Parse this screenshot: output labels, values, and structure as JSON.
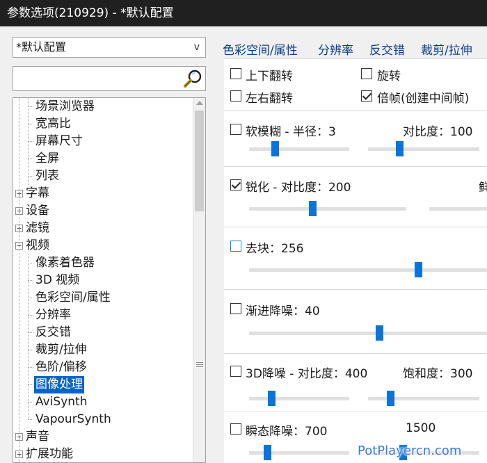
{
  "window": {
    "title": "参数选项(210929) - *默认配置"
  },
  "profile": {
    "selected": "*默认配置",
    "arrow": "v"
  },
  "search": {
    "value": "",
    "placeholder": ""
  },
  "tree": {
    "items": [
      {
        "label": "场景浏览器",
        "level": 1
      },
      {
        "label": "宽高比",
        "level": 1
      },
      {
        "label": "屏幕尺寸",
        "level": 1
      },
      {
        "label": "全屏",
        "level": 1
      },
      {
        "label": "列表",
        "level": 1
      },
      {
        "label": "字幕",
        "level": 0,
        "expander": "+"
      },
      {
        "label": "设备",
        "level": 0,
        "expander": "+"
      },
      {
        "label": "滤镜",
        "level": 0,
        "expander": "+"
      },
      {
        "label": "视频",
        "level": 0,
        "expander": "−"
      },
      {
        "label": "像素着色器",
        "level": 1
      },
      {
        "label": "3D 视频",
        "level": 1
      },
      {
        "label": "色彩空间/属性",
        "level": 1
      },
      {
        "label": "分辨率",
        "level": 1
      },
      {
        "label": "反交错",
        "level": 1
      },
      {
        "label": "裁剪/拉伸",
        "level": 1
      },
      {
        "label": "色阶/偏移",
        "level": 1
      },
      {
        "label": "图像处理",
        "level": 1,
        "selected": true
      },
      {
        "label": "AviSynth",
        "level": 1
      },
      {
        "label": "VapourSynth",
        "level": 1
      },
      {
        "label": "声音",
        "level": 0,
        "expander": "+"
      },
      {
        "label": "扩展功能",
        "level": 0,
        "expander": "+"
      }
    ]
  },
  "tabs": [
    "色彩空间/属性",
    "分辨率",
    "反交错",
    "裁剪/拉伸"
  ],
  "options": {
    "flip_vertical": {
      "label": "上下翻转",
      "checked": false
    },
    "rotate": {
      "label": "旋转",
      "checked": false
    },
    "flip_horizontal": {
      "label": "左右翻转",
      "checked": false
    },
    "double_frame": {
      "label": "倍帧(创建中间帧)",
      "checked": true
    }
  },
  "filters": {
    "soft_blur": {
      "label": "软模糊 - 半径：3",
      "checked": false,
      "value": 0.24,
      "contrast_label": "对比度：100",
      "contrast_value": 0.27
    },
    "sharpen": {
      "label": "锐化 - 对比度：200",
      "checked": true,
      "value": 0.4,
      "extra_label": "鲜"
    },
    "deblock": {
      "label": "去块：256",
      "checked": false,
      "value": 0.72
    },
    "progressive_denoise": {
      "label": "渐进降噪：40",
      "checked": false,
      "value": 0.55
    },
    "denoise_3d": {
      "label": "3D降噪 - 对比度：400",
      "checked": false,
      "value": 0.2,
      "saturation_label": "饱和度：300",
      "saturation_value": 0.18
    },
    "temporal_denoise": {
      "label": "瞬态降噪：700",
      "checked": false,
      "value": 0.16,
      "value_label": "1500",
      "second_value": 0.3
    }
  },
  "watermark": "PotPlayercn.com",
  "colors": {
    "titlebar": "#202020",
    "accent": "#0a74da",
    "selection": "#0a64c8",
    "tab_text": "#0a3c8c"
  }
}
